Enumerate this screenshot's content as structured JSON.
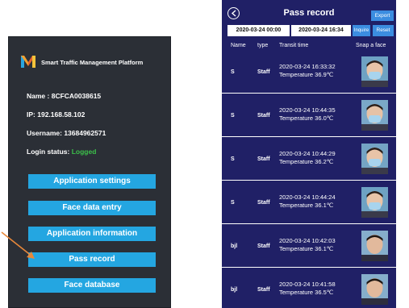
{
  "left_panel": {
    "platform_title": "Smart Traffic Management Platform",
    "name_label": "Name : ",
    "name_value": "8CFCA0038615",
    "ip_label": "IP: ",
    "ip_value": "192.168.58.102",
    "username_label": "Username: ",
    "username_value": "13684962571",
    "status_label": "Login status: ",
    "status_value": "Logged",
    "menu": [
      {
        "label": "Application settings"
      },
      {
        "label": "Face data entry"
      },
      {
        "label": "Application information"
      },
      {
        "label": "Pass record"
      },
      {
        "label": "Face database"
      }
    ],
    "colors": {
      "panel_bg": "#2b2f36",
      "button_bg": "#24a6e1",
      "logged": "#3cc04a",
      "arrow": "#e8883a"
    }
  },
  "phone": {
    "title": "Pass record",
    "export_label": "Export",
    "start_date": "2020-03-24 00:00",
    "end_date": "2020-03-24 16:34",
    "inquire_label": "Inquire",
    "reset_label": "Reset",
    "columns": {
      "name": "Name",
      "type": "type",
      "time": "Transit time",
      "face": "Snap a face"
    },
    "records": [
      {
        "name": "S",
        "type": "Staff",
        "time": "2020-03-24 16:33:32",
        "temp": "Temperature 36.9℃"
      },
      {
        "name": "S",
        "type": "Staff",
        "time": "2020-03-24 10:44:35",
        "temp": "Temperature 36.0℃"
      },
      {
        "name": "S",
        "type": "Staff",
        "time": "2020-03-24 10:44:29",
        "temp": "Temperature 36.2℃"
      },
      {
        "name": "S",
        "type": "Staff",
        "time": "2020-03-24 10:44:24",
        "temp": "Temperature 36.1℃"
      },
      {
        "name": "bjl",
        "type": "Staff",
        "time": "2020-03-24 10:42:03",
        "temp": "Temperature 36.1℃"
      },
      {
        "name": "bjl",
        "type": "Staff",
        "time": "2020-03-24 10:41:58",
        "temp": "Temperature 36.5℃"
      }
    ],
    "colors": {
      "bg": "#202066",
      "button": "#3b8de0"
    }
  }
}
